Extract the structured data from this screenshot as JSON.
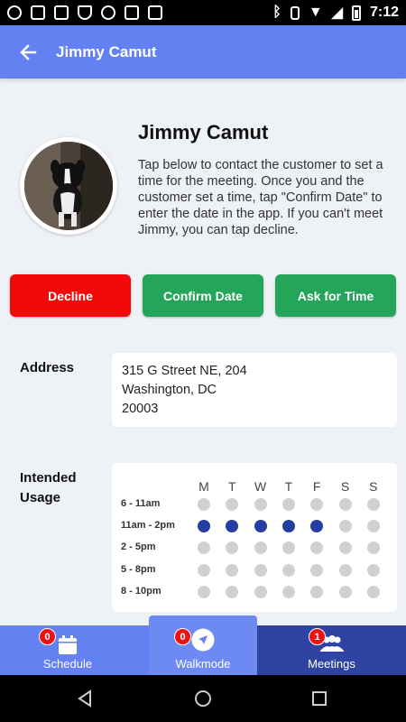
{
  "status_bar": {
    "time": "7:12"
  },
  "app_bar": {
    "title": "Jimmy Camut"
  },
  "profile": {
    "name": "Jimmy Camut",
    "description": "Tap below to contact the customer to set a time for the meeting. Once you and the customer set a time, tap \"Confirm Date\" to enter the date in the app. If you can't meet Jimmy, you can tap decline."
  },
  "actions": {
    "decline": "Decline",
    "confirm": "Confirm Date",
    "ask": "Ask for Time"
  },
  "colors": {
    "accent": "#6381f0",
    "decline": "#f20a0a",
    "confirm": "#25a55a",
    "selected_dot": "#253fa0",
    "dark_tab": "#2f43a2"
  },
  "address": {
    "label": "Address",
    "lines": [
      "315 G Street NE, 204",
      "Washington, DC",
      "20003"
    ]
  },
  "usage": {
    "label_line1": "Intended",
    "label_line2": "Usage",
    "days": [
      "M",
      "T",
      "W",
      "T",
      "F",
      "S",
      "S"
    ],
    "slots": [
      "6 - 11am",
      "11am - 2pm",
      "2 - 5pm",
      "5 - 8pm",
      "8 - 10pm"
    ],
    "selected": [
      [
        false,
        false,
        false,
        false,
        false,
        false,
        false
      ],
      [
        true,
        true,
        true,
        true,
        true,
        false,
        false
      ],
      [
        false,
        false,
        false,
        false,
        false,
        false,
        false
      ],
      [
        false,
        false,
        false,
        false,
        false,
        false,
        false
      ],
      [
        false,
        false,
        false,
        false,
        false,
        false,
        false
      ]
    ]
  },
  "tabs": [
    {
      "label": "Schedule",
      "badge": "0",
      "icon": "calendar-icon"
    },
    {
      "label": "Walkmode",
      "badge": "0",
      "icon": "navigation-icon"
    },
    {
      "label": "Meetings",
      "badge": "1",
      "icon": "people-icon"
    }
  ]
}
